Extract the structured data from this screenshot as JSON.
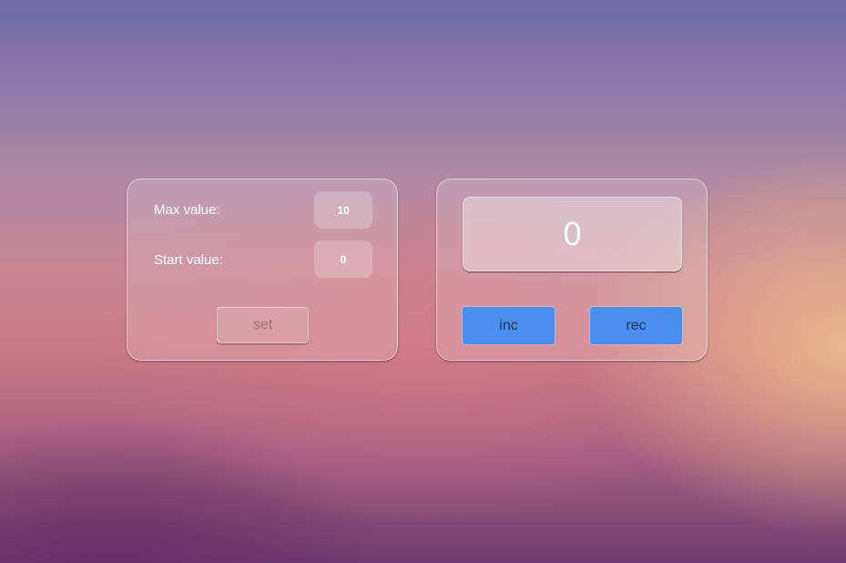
{
  "settings": {
    "max_label": "Max value:",
    "max_value": "10",
    "start_label": "Start value:",
    "start_value": "0",
    "set_label": "set"
  },
  "counter": {
    "display_value": "0",
    "inc_label": "inc",
    "rec_label": "rec"
  },
  "colors": {
    "button_blue": "#4a8ef0"
  }
}
